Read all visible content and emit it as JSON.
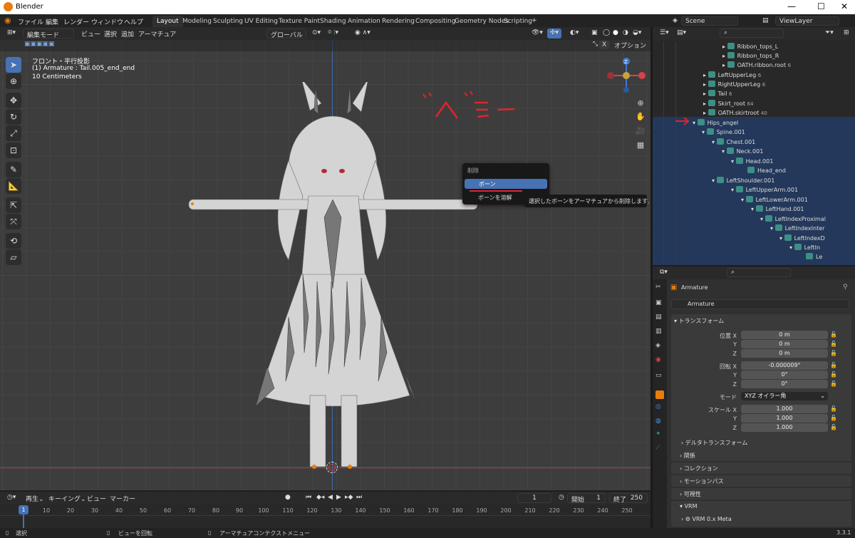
{
  "window": {
    "title": "Blender",
    "min": "—",
    "max": "☐",
    "close": "✕"
  },
  "menu": [
    "ファイル",
    "編集",
    "レンダー",
    "ウィンドウ",
    "ヘルプ"
  ],
  "workspace_tabs": [
    "Layout",
    "Modeling",
    "Sculpting",
    "UV Editing",
    "Texture Paint",
    "Shading",
    "Animation",
    "Rendering",
    "Compositing",
    "Geometry Nodes",
    "Scripting"
  ],
  "scene": "Scene",
  "view_layer": "ViewLayer",
  "vp_header": {
    "mode": "編集モード",
    "items": [
      "ビュー",
      "選択",
      "追加",
      "アーマチュア"
    ],
    "transform": "グローバル",
    "options": "オプション"
  },
  "vp_info": {
    "view": "フロント・平行投影",
    "object": "(1) Armature : Tail.005_end_end",
    "scale": "10 Centimeters"
  },
  "annotation": "ヘ゛ーー",
  "delete_menu": {
    "header": "削除",
    "items": [
      "ボーン",
      "ボーンを溶解"
    ],
    "tooltip": "選択したボーンをアーマチュアから削除します."
  },
  "outliner": [
    {
      "name": "Ribbon_tops_L",
      "count": ""
    },
    {
      "name": "Ribbon_tops_R",
      "count": ""
    },
    {
      "name": "OATH.ribbon.root",
      "count": "6"
    },
    {
      "name": "LeftUpperLeg",
      "count": "6"
    },
    {
      "name": "RightUpperLeg",
      "count": "6"
    },
    {
      "name": "Tail",
      "count": "6"
    },
    {
      "name": "Skirt_root",
      "count": "64"
    },
    {
      "name": "OATH.skirtroot",
      "count": "40"
    },
    {
      "name": "Hips_angel",
      "count": ""
    },
    {
      "name": "Spine.001",
      "count": ""
    },
    {
      "name": "Chest.001",
      "count": ""
    },
    {
      "name": "Neck.001",
      "count": ""
    },
    {
      "name": "Head.001",
      "count": ""
    },
    {
      "name": "Head_end",
      "count": ""
    },
    {
      "name": "LeftShoulder.001",
      "count": ""
    },
    {
      "name": "LeftUpperArm.001",
      "count": ""
    },
    {
      "name": "LeftLowerArm.001",
      "count": ""
    },
    {
      "name": "LeftHand.001",
      "count": ""
    },
    {
      "name": "LeftIndexProximal",
      "count": ""
    },
    {
      "name": "LeftIndexInter",
      "count": ""
    },
    {
      "name": "LeftIndexD",
      "count": ""
    },
    {
      "name": "LeftIn",
      "count": ""
    },
    {
      "name": "Le",
      "count": ""
    }
  ],
  "props": {
    "object": "Armature",
    "data": "Armature",
    "transform": "トランスフォーム",
    "loc_label": "位置 X",
    "y": "Y",
    "z": "Z",
    "loc": [
      "0 m",
      "0 m",
      "0 m"
    ],
    "rot_label": "回転 X",
    "rot": [
      "-0.000009°",
      "0°",
      "0°"
    ],
    "mode_label": "モード",
    "mode": "XYZ オイラー角",
    "scale_label": "スケール X",
    "scale": [
      "1.000",
      "1.000",
      "1.000"
    ],
    "panels": [
      "デルタトランスフォーム",
      "関係",
      "コレクション",
      "モーションパス",
      "可視性",
      "VRM"
    ],
    "vrm_sub": "VRM 0.x Meta",
    "version": "3.3.1"
  },
  "timeline": {
    "items": [
      "再生",
      "キーイング",
      "ビュー",
      "マーカー"
    ],
    "frame": "1",
    "start_label": "開始",
    "start": "1",
    "end_label": "終了",
    "end": "250",
    "ticks": [
      "10",
      "20",
      "30",
      "40",
      "50",
      "60",
      "70",
      "80",
      "90",
      "100",
      "110",
      "120",
      "130",
      "140",
      "150",
      "160",
      "170",
      "180",
      "190",
      "200",
      "210",
      "220",
      "230",
      "240",
      "250"
    ],
    "current": "1"
  },
  "status": [
    "選択",
    "ビューを回転",
    "アーマチュアコンテクストメニュー"
  ]
}
